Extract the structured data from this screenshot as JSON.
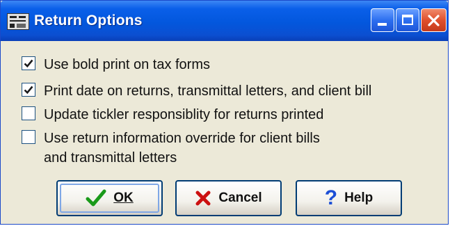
{
  "window": {
    "title": "Return Options",
    "icons": {
      "app": "app-icon",
      "minimize": "minimize-icon",
      "maximize": "maximize-icon",
      "close": "close-icon"
    }
  },
  "options": [
    {
      "label": "Use bold print on tax forms",
      "checked": true
    },
    {
      "label": "Print date on returns, transmittal letters, and client bill",
      "checked": true
    },
    {
      "label": "Update tickler responsiblity for returns printed",
      "checked": false
    },
    {
      "label": "Use return information override for client bills\nand transmittal letters",
      "checked": false
    }
  ],
  "buttons": {
    "ok": {
      "label": "OK",
      "icon": "checkmark-icon"
    },
    "cancel": {
      "label": "Cancel",
      "icon": "x-icon"
    },
    "help": {
      "label": "Help",
      "icon": "question-mark-icon"
    }
  },
  "colors": {
    "title_bar": "#0357dd",
    "close_button": "#e0502d",
    "dialog_bg": "#ece9d8",
    "check_green": "#1a9a1a",
    "cancel_red": "#cc1111",
    "help_blue": "#1c4fd6"
  }
}
